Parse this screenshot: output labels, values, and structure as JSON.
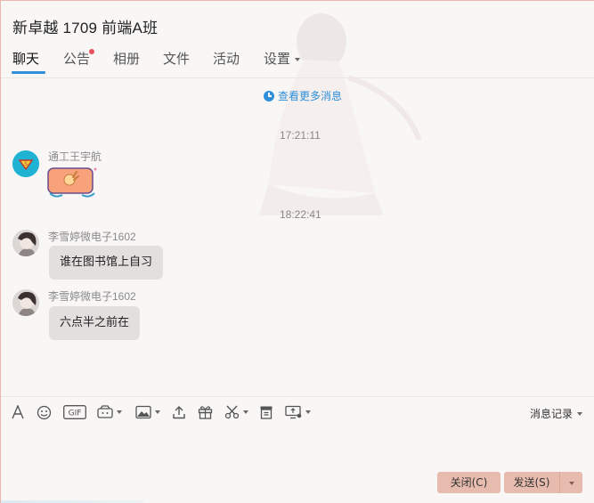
{
  "window": {
    "title": "新卓越 1709 前端A班"
  },
  "tabs": [
    {
      "label": "聊天",
      "active": true
    },
    {
      "label": "公告",
      "has_notification": true
    },
    {
      "label": "相册"
    },
    {
      "label": "文件"
    },
    {
      "label": "活动"
    },
    {
      "label": "设置",
      "has_dropdown": true
    }
  ],
  "chat": {
    "more_messages": "查看更多消息",
    "messages": [
      {
        "time": "17:21:11",
        "sender": "通工王宇航",
        "type": "sticker",
        "avatar": "superman-avatar"
      },
      {
        "time": "18:22:41",
        "sender": "李雪婷微电子1602",
        "type": "text",
        "text": "谁在图书馆上自习",
        "avatar": "girl-avatar"
      },
      {
        "sender": "李雪婷微电子1602",
        "type": "text",
        "text": "六点半之前在",
        "avatar": "girl-avatar"
      }
    ]
  },
  "toolbar": {
    "icons": [
      "font-icon",
      "emoji-icon",
      "gif-icon",
      "magic-emoji-icon",
      "image-icon",
      "upload-icon",
      "gift-icon",
      "screenshot-icon",
      "file-cabinet-icon",
      "screen-share-icon"
    ],
    "gif_label": "GIF",
    "history_label": "消息记录"
  },
  "buttons": {
    "close": "关闭(C)",
    "send": "发送(S)"
  },
  "colors": {
    "accent": "#2f8fd8",
    "button_bg": "#e7bcae",
    "bubble_bg": "#e2dfde",
    "notification_dot": "#e8505b"
  }
}
